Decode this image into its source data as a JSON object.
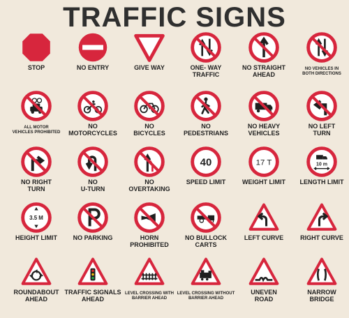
{
  "title": "TRAFFIC SIGNS",
  "signs": [
    {
      "label": "STOP",
      "icon": "stop-octagon-icon"
    },
    {
      "label": "NO ENTRY",
      "icon": "no-entry-icon"
    },
    {
      "label": "GIVE WAY",
      "icon": "give-way-triangle-icon"
    },
    {
      "label": "ONE- WAY\nTRAFFIC",
      "icon": "one-way-arrows-icon"
    },
    {
      "label": "NO STRAIGHT\nAHEAD",
      "icon": "no-straight-ahead-icon"
    },
    {
      "label": "NO VEHICLES IN\nBOTH DIRECTIONS",
      "icon": "no-vehicles-both-directions-icon"
    },
    {
      "label": "ALL MOTOR\nVEHICLES PROHIBITED",
      "icon": "all-motor-vehicles-prohibited-icon"
    },
    {
      "label": "NO\nMOTORCYCLES",
      "icon": "no-motorcycles-icon"
    },
    {
      "label": "NO\nBICYCLES",
      "icon": "no-bicycles-icon"
    },
    {
      "label": "NO\nPEDESTRIANS",
      "icon": "no-pedestrians-icon"
    },
    {
      "label": "NO HEAVY\nVEHICLES",
      "icon": "no-heavy-vehicles-icon"
    },
    {
      "label": "NO LEFT\nTURN",
      "icon": "no-left-turn-icon"
    },
    {
      "label": "NO RIGHT\nTURN",
      "icon": "no-right-turn-icon"
    },
    {
      "label": "NO\nU-TURN",
      "icon": "no-u-turn-icon"
    },
    {
      "label": "NO\nOVERTAKING",
      "icon": "no-overtaking-icon"
    },
    {
      "label": "SPEED LIMIT",
      "icon": "speed-limit-icon",
      "text": "40"
    },
    {
      "label": "WEIGHT LIMIT",
      "icon": "weight-limit-icon",
      "text": "17 T"
    },
    {
      "label": "LENGTH LIMIT",
      "icon": "length-limit-icon",
      "text": "10 m"
    },
    {
      "label": "HEIGHT LIMIT",
      "icon": "height-limit-icon",
      "text": "3.5 M"
    },
    {
      "label": "NO PARKING",
      "icon": "no-parking-icon"
    },
    {
      "label": "HORN\nPROHIBITED",
      "icon": "horn-prohibited-icon"
    },
    {
      "label": "NO BULLOCK\nCARTS",
      "icon": "no-bullock-carts-icon"
    },
    {
      "label": "LEFT CURVE",
      "icon": "left-curve-icon"
    },
    {
      "label": "RIGHT CURVE",
      "icon": "right-curve-icon"
    },
    {
      "label": "ROUNDABOUT\nAHEAD",
      "icon": "roundabout-ahead-icon"
    },
    {
      "label": "TRAFFIC SIGNALS\nAHEAD",
      "icon": "traffic-signals-ahead-icon"
    },
    {
      "label": "LEVEL CROSSING WITH\nBARRIER AHEAD",
      "icon": "level-crossing-with-barrier-icon"
    },
    {
      "label": "LEVEL CROSSING WITHOUT\nBARRIER AHEAD",
      "icon": "level-crossing-without-barrier-icon"
    },
    {
      "label": "UNEVEN\nROAD",
      "icon": "uneven-road-icon"
    },
    {
      "label": "NARROW\nBRIDGE",
      "icon": "narrow-bridge-icon"
    }
  ],
  "colors": {
    "red": "#d7263d",
    "dark": "#1f1f1f",
    "background": "#f1e9dc"
  }
}
